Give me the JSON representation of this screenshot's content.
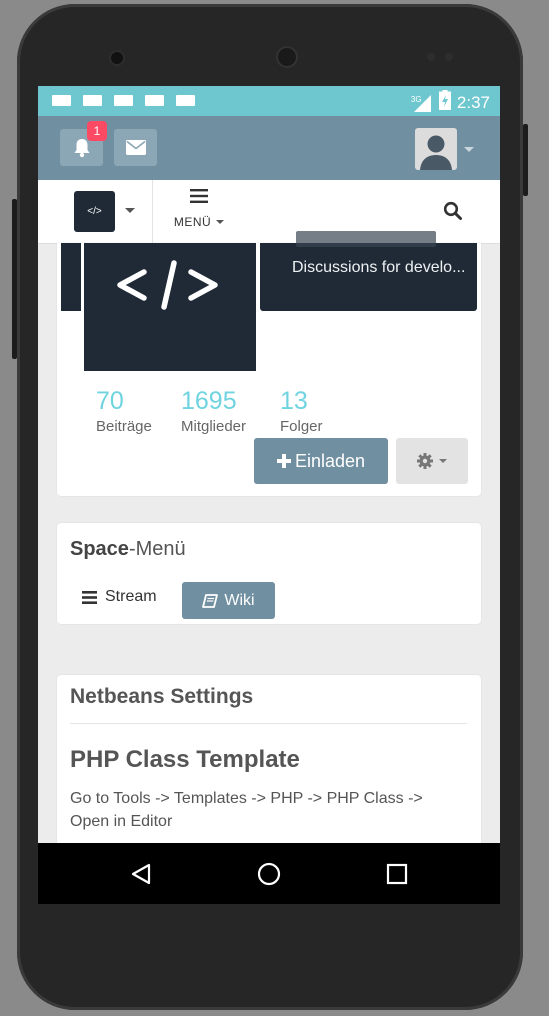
{
  "statusbar": {
    "network": "3G",
    "time": "2:37"
  },
  "topbar": {
    "notifications_badge": "1"
  },
  "navbar": {
    "menu_label": "MENÜ",
    "space_logo_text": "</>"
  },
  "space": {
    "banner_subtitle": "Discussions for develo...",
    "stats": [
      {
        "value": "70",
        "label": "Beiträge"
      },
      {
        "value": "1695",
        "label": "Mitglieder"
      },
      {
        "value": "13",
        "label": "Folger"
      }
    ],
    "invite_label": "Einladen"
  },
  "space_menu": {
    "title_bold": "Space",
    "title_rest": "-Menü",
    "items": [
      {
        "label": "Stream"
      },
      {
        "label": "Wiki"
      }
    ]
  },
  "wiki": {
    "heading": "Netbeans Settings",
    "subheading": "PHP Class Template",
    "text": "Go to Tools -> Templates -> PHP -> PHP Class -> Open in Editor"
  },
  "colors": {
    "accent": "#708fa0",
    "status_bar": "#6ec7cf",
    "stat_number": "#6fd3e0",
    "badge": "#fc4a64",
    "space_dark": "#1f2a36"
  }
}
